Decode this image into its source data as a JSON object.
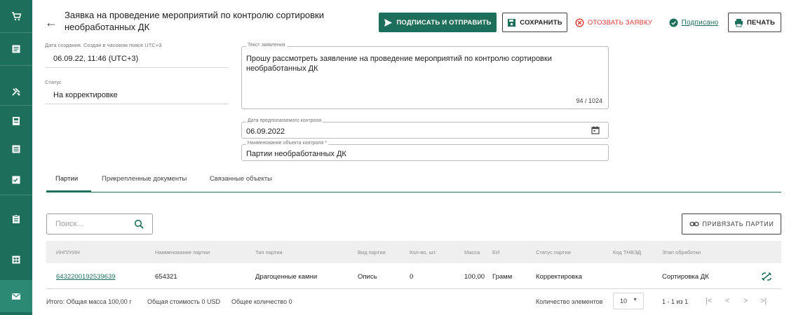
{
  "header": {
    "title": "Заявка на проведение мероприятий по контролю сортировки необработанных ДК",
    "sign_send_label": "ПОДПИСАТЬ И ОТПРАВИТЬ",
    "save_label": "СОХРАНИТЬ",
    "recall_label": "ОТОЗВАТЬ ЗАЯВКУ",
    "signed_label": "Подписано",
    "print_label": "ПЕЧАТЬ"
  },
  "info": {
    "created_caption": "Дата создания. Создан в часовом поясе UTC+3",
    "created_value": "06.09.22, 11:46 (UTC+3)",
    "status_caption": "Статус",
    "status_value": "На корректировке"
  },
  "form": {
    "statement_label": "Текст заявления",
    "statement_value": "Прошу рассмотреть заявление на проведение мероприятий по контролю сортировки необработанных ДК",
    "statement_counter": "94 / 1024",
    "date_label": "Дата предполагаемого контроля",
    "date_value": "06.09.2022",
    "object_label": "Наименование объекта контроля *",
    "object_value": "Партии необработанных ДК"
  },
  "tabs": [
    {
      "label": "Партии"
    },
    {
      "label": "Прикрепленные документы"
    },
    {
      "label": "Связанные объекты"
    }
  ],
  "toolbar": {
    "search_placeholder": "Поиск...",
    "bind_label": "ПРИВЯЗАТЬ ПАРТИИ"
  },
  "table": {
    "columns": [
      "ИНП/УИН",
      "Наименование партии",
      "Тип партии",
      "Вид партии",
      "Кол-во, шт.",
      "Масса",
      "ЕИ",
      "Статус партии",
      "Код ТНВЭД",
      "Этап обработки"
    ],
    "rows": [
      {
        "inp": "6432200192539639",
        "name": "654321",
        "type": "Драгоценные камни",
        "kind": "Опись",
        "qty": "0",
        "mass": "100,00",
        "unit": "Грамм",
        "status": "Корректировка",
        "tnved": "",
        "stage": "Сортировка ДК"
      }
    ]
  },
  "footer": {
    "total_mass": "Итого: Общая масса 100,00 г",
    "total_cost": "Общая стоимость 0 USD",
    "total_qty": "Общее количество 0",
    "per_page_label": "Количество элементов",
    "per_page_value": "10",
    "range": "1 - 1 из 1"
  },
  "icons": {
    "first": "|<",
    "prev": "<",
    "next": ">",
    "last": ">|"
  },
  "colors": {
    "brand": "#1e6e5c",
    "danger": "#e53935"
  }
}
